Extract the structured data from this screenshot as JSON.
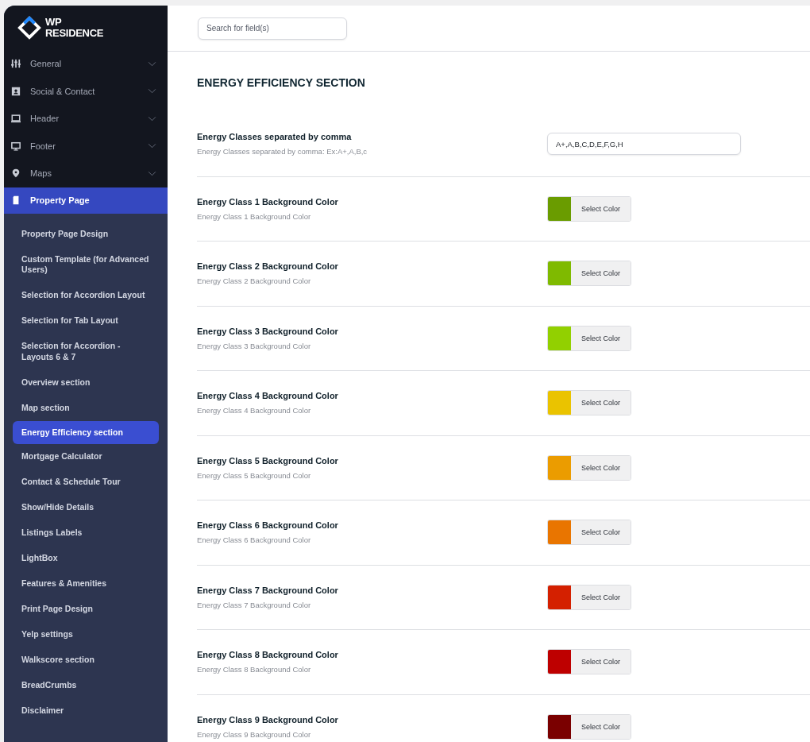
{
  "logo": {
    "line_1": "WP",
    "line_2": "RESIDENCE"
  },
  "sidebar": {
    "items": [
      {
        "label": "General",
        "kind": "sliders",
        "selected": false
      },
      {
        "label": "Social & Contact",
        "kind": "contact",
        "selected": false
      },
      {
        "label": "Header",
        "kind": "laptop",
        "selected": false
      },
      {
        "label": "Footer",
        "kind": "monitor",
        "selected": false
      },
      {
        "label": "Maps",
        "kind": "pin",
        "selected": false
      },
      {
        "label": "Property Page",
        "kind": "document",
        "selected": true
      }
    ],
    "subitems": [
      {
        "label": "Property Page Design",
        "selected": false
      },
      {
        "label": "Custom Template (for Advanced Users)",
        "selected": false
      },
      {
        "label": "Selection for Accordion Layout",
        "selected": false
      },
      {
        "label": "Selection for Tab Layout",
        "selected": false
      },
      {
        "label": "Selection for Accordion - Layouts 6 & 7",
        "selected": false
      },
      {
        "label": "Overview section",
        "selected": false
      },
      {
        "label": "Map section",
        "selected": false
      },
      {
        "label": "Energy Efficiency section",
        "selected": true
      },
      {
        "label": "Mortgage Calculator",
        "selected": false
      },
      {
        "label": "Contact & Schedule Tour",
        "selected": false
      },
      {
        "label": "Show/Hide Details",
        "selected": false
      },
      {
        "label": "Listings Labels",
        "selected": false
      },
      {
        "label": "LightBox",
        "selected": false
      },
      {
        "label": "Features & Amenities",
        "selected": false
      },
      {
        "label": "Print Page Design",
        "selected": false
      },
      {
        "label": "Yelp settings",
        "selected": false
      },
      {
        "label": "Walkscore section",
        "selected": false
      },
      {
        "label": "BreadCrumbs",
        "selected": false
      },
      {
        "label": "Disclaimer",
        "selected": false
      }
    ]
  },
  "search": {
    "placeholder": "Search for field(s)"
  },
  "section_title": "ENERGY EFFICIENCY SECTION",
  "fields": [
    {
      "kind": "text",
      "title": "Energy Classes separated by comma",
      "description": "Energy Classes separated by comma: Ex:A+,A,B,c",
      "value": "A+,A,B,C,D,E,F,G,H"
    },
    {
      "kind": "color",
      "title": "Energy Class 1 Background Color",
      "description": "Energy Class 1 Background Color",
      "color": "#6a9c00",
      "button": "Select Color"
    },
    {
      "kind": "color",
      "title": "Energy Class 2 Background Color",
      "description": "Energy Class 2 Background Color",
      "color": "#7fba00",
      "button": "Select Color"
    },
    {
      "kind": "color",
      "title": "Energy Class 3 Background Color",
      "description": "Energy Class 3 Background Color",
      "color": "#92d000",
      "button": "Select Color"
    },
    {
      "kind": "color",
      "title": "Energy Class 4 Background Color",
      "description": "Energy Class 4 Background Color",
      "color": "#eac300",
      "button": "Select Color"
    },
    {
      "kind": "color",
      "title": "Energy Class 5 Background Color",
      "description": "Energy Class 5 Background Color",
      "color": "#eb9c00",
      "button": "Select Color"
    },
    {
      "kind": "color",
      "title": "Energy Class 6 Background Color",
      "description": "Energy Class 6 Background Color",
      "color": "#e97500",
      "button": "Select Color"
    },
    {
      "kind": "color",
      "title": "Energy Class 7 Background Color",
      "description": "Energy Class 7 Background Color",
      "color": "#d42000",
      "button": "Select Color"
    },
    {
      "kind": "color",
      "title": "Energy Class 8 Background Color",
      "description": "Energy Class 8 Background Color",
      "color": "#be0000",
      "button": "Select Color"
    },
    {
      "kind": "color",
      "title": "Energy Class 9 Background Color",
      "description": "Energy Class 9 Background Color",
      "color": "#7a0000",
      "button": "Select Color"
    }
  ]
}
